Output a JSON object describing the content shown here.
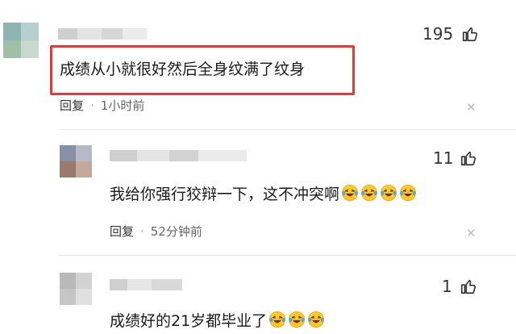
{
  "comments": [
    {
      "likes": "195",
      "text": "成绩从小就很好然后全身纹满了纹身",
      "reply_label": "回复",
      "time": "1小时前",
      "emoji_count": 0
    },
    {
      "likes": "11",
      "text": "我给你强行狡辩一下，这不冲突啊",
      "reply_label": "回复",
      "time": "52分钟前",
      "emoji_count": 4
    },
    {
      "likes": "1",
      "text": "成绩好的21岁都毕业了",
      "emoji_count": 3
    }
  ],
  "icons": {
    "like": "thumbs-up-icon",
    "close": "close-icon",
    "emoji": "laughing-tears-emoji"
  },
  "colors": {
    "highlight_border": "#e53935",
    "meta_text": "#666666",
    "divider": "#e6e6e6"
  }
}
